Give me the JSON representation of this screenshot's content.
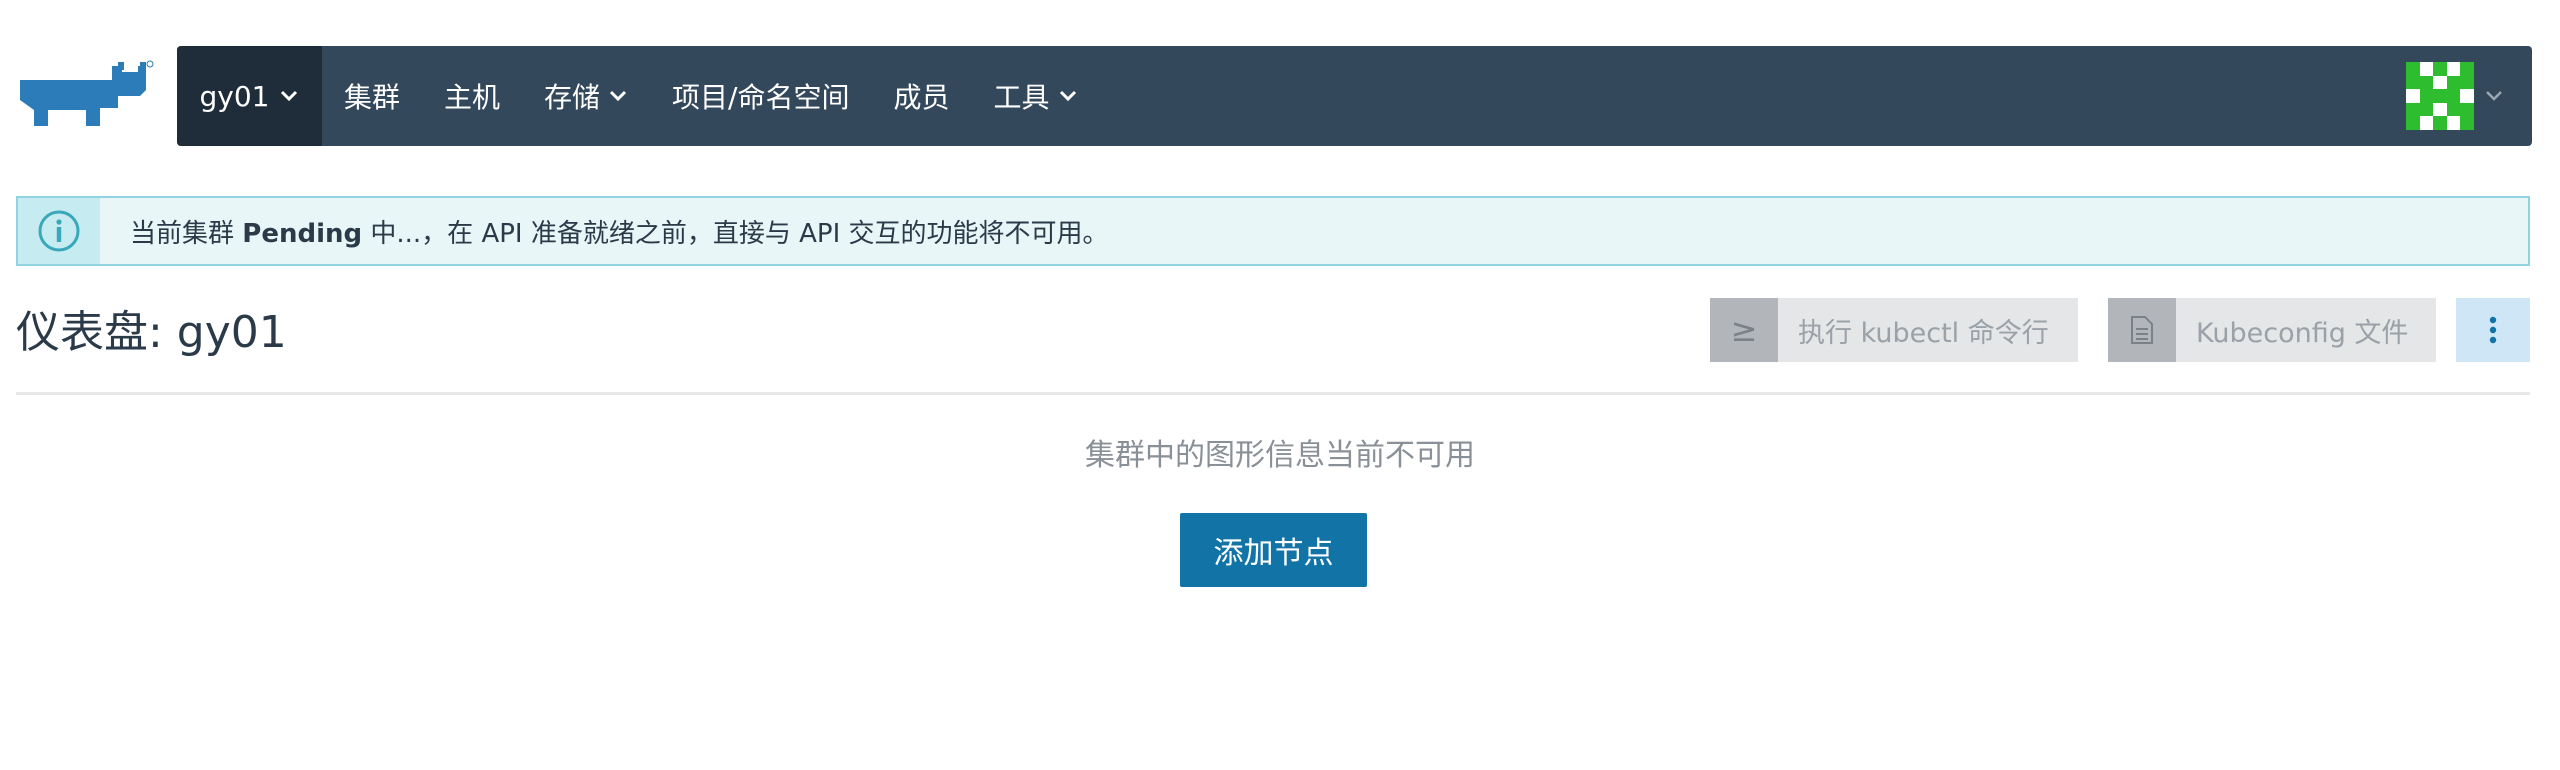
{
  "header": {
    "logo_icon": "rancher-cow-logo",
    "cluster_name": "gy01",
    "nav_items": [
      {
        "label": "集群",
        "has_dropdown": false
      },
      {
        "label": "主机",
        "has_dropdown": false
      },
      {
        "label": "存储",
        "has_dropdown": true
      },
      {
        "label": "项目/命名空间",
        "has_dropdown": false
      },
      {
        "label": "成员",
        "has_dropdown": false
      },
      {
        "label": "工具",
        "has_dropdown": true
      }
    ],
    "avatar_icon": "identicon-avatar",
    "colors": {
      "nav_bg": "#34485c",
      "cluster_bg": "#1f2d3a",
      "avatar_green": "#2ebd2e"
    }
  },
  "banner": {
    "icon": "info-icon",
    "text_prefix": "当前集群",
    "text_bold": "Pending",
    "text_suffix": "中...，在 API 准备就绪之前，直接与 API 交互的功能将不可用。",
    "colors": {
      "bg": "#e8f6f8",
      "border": "#8fd4e0",
      "icon": "#3aa8b8"
    }
  },
  "page": {
    "title": "仪表盘: gy01",
    "buttons": {
      "kubectl": {
        "icon": "≥",
        "label": "执行 kubectl 命令行"
      },
      "kubeconfig": {
        "icon": "file-icon",
        "label": "Kubeconfig 文件"
      },
      "more": {
        "icon": "vertical-ellipsis-icon"
      }
    },
    "empty_message": "集群中的图形信息当前不可用",
    "add_node_label": "添加节点",
    "colors": {
      "primary": "#1173a6"
    }
  }
}
